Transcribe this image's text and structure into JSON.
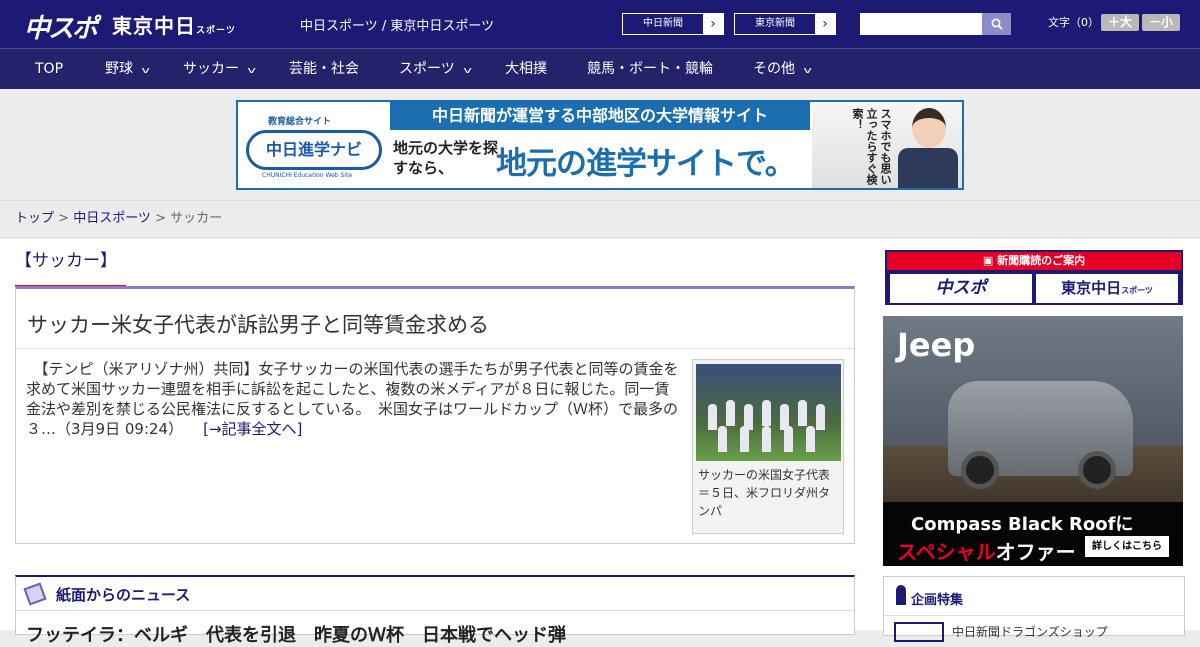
{
  "header": {
    "logo_main": "中スポ",
    "logo_tokyo": "東京中日",
    "logo_tokyo_suffix": "スポーツ",
    "site_links": "中日スポーツ / 東京中日スポーツ",
    "button_chunichi": "中日新聞",
    "button_tokyo": "東京新聞",
    "search_placeholder": "",
    "font_size_label": "文字（0）",
    "font_larger": "＋大",
    "font_smaller": "－小"
  },
  "nav": {
    "items": [
      {
        "label": "TOP"
      },
      {
        "label": "野球"
      },
      {
        "label": "サッカー"
      },
      {
        "label": "芸能・社会"
      },
      {
        "label": "スポーツ"
      },
      {
        "label": "大相撲"
      },
      {
        "label": "競馬・ボート・競輪"
      },
      {
        "label": "その他"
      }
    ]
  },
  "banner": {
    "site_tag": "教育総合サイト",
    "logo_text": "中日進学ナビ",
    "logo_en": "CHUNICHI Education Web Site",
    "headline": "中日新聞が運営する中部地区の大学情報サイト",
    "sub": "地元の大学を探すなら、",
    "big": "地元の進学サイトで。",
    "vertical": "スマホでも思い立ったらすぐ検索！"
  },
  "breadcrumb": {
    "home": "トップ",
    "parent": "中日スポーツ",
    "current": "サッカー",
    "sep": " > "
  },
  "section_title": "【サッカー】",
  "article": {
    "title": "サッカー米女子代表が訴訟男子と同等賃金求める",
    "body": "【テンピ（米アリゾナ州）共同】女子サッカーの米国代表の選手たちが男子代表と同等の賃金を求めて米国サッカー連盟を相手に訴訟を起こしたと、複数の米メディアが８日に報じた。同一賃金法や差別を禁じる公民権法に反するとしている。　米国女子はワールドカップ（Ｗ杯）で最多の３…",
    "timestamp": "（3月9日 09:24）",
    "more_link": "[→記事全文へ]",
    "photo_caption": "サッカーの米国女子代表＝５日、米フロリダ州タンパ"
  },
  "news": {
    "heading": "紙面からのニュース",
    "first_headline": "フッテイラ：ベルギ　代表を引退　昨夏のＷ杯　日本戦でヘッド弾"
  },
  "sidebar": {
    "subscribe_heading": "新聞購読のご案内",
    "subscribe_a": "中スポ",
    "subscribe_b": "東京中日",
    "subscribe_b_suffix": "スポーツ",
    "ad": {
      "brand": "Jeep",
      "line1": "Compass Black Roofに",
      "line2_red": "スペシャル",
      "line2_white": "オファー",
      "cta": "詳しくはこちら"
    },
    "plan_heading": "企画特集",
    "plan_item": "中日新聞ドラゴンズショップ"
  }
}
